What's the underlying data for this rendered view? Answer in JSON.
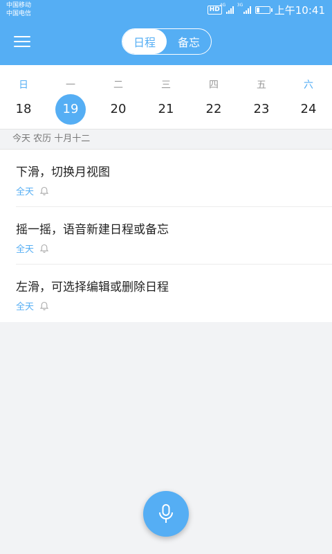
{
  "status_bar": {
    "carrier_1": "中国移动",
    "carrier_2": "中国电信",
    "hd": "HD",
    "net_1": "4G",
    "net_2": "3G",
    "time": "上午10:41"
  },
  "header": {
    "tab_schedule": "日程",
    "tab_memo": "备忘",
    "menu_icon": "hamburger-icon"
  },
  "week": {
    "weekdays": [
      "日",
      "一",
      "二",
      "三",
      "四",
      "五",
      "六"
    ],
    "dates": [
      "18",
      "19",
      "20",
      "21",
      "22",
      "23",
      "24"
    ],
    "selected_index": 1
  },
  "date_info": "今天 农历 十月十二",
  "items": [
    {
      "title": "下滑，切换月视图",
      "tag": "全天",
      "icon": "bell-icon"
    },
    {
      "title": "摇一摇，语音新建日程或备忘",
      "tag": "全天",
      "icon": "bell-icon"
    },
    {
      "title": "左滑，可选择编辑或删除日程",
      "tag": "全天",
      "icon": "bell-icon"
    }
  ],
  "fab_icon": "microphone-icon",
  "colors": {
    "accent": "#55aef4",
    "background": "#f2f3f5"
  }
}
